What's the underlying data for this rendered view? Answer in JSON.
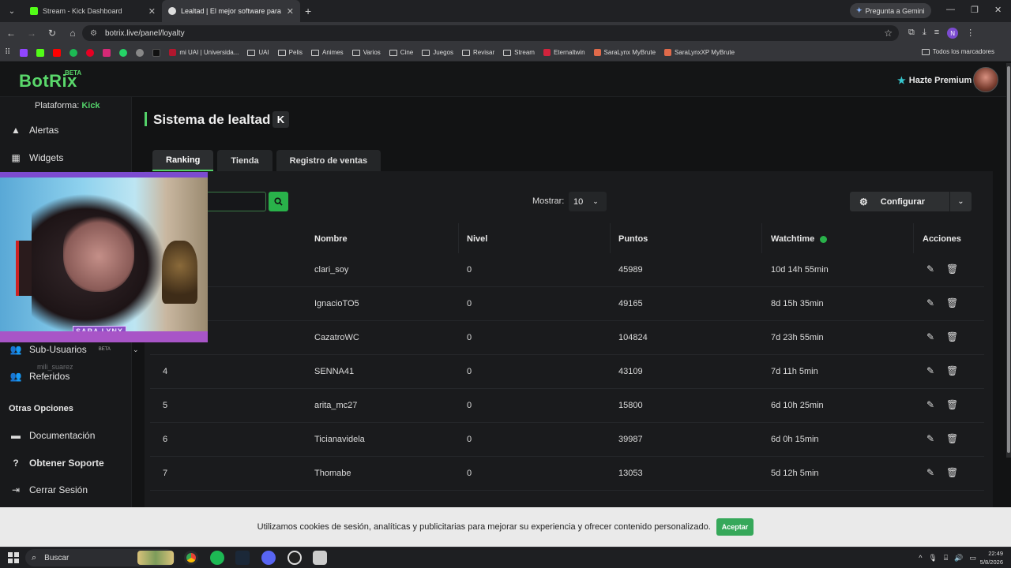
{
  "browser": {
    "tabs": [
      {
        "title": "Stream - Kick Dashboard",
        "favicon_color": "#53fc18"
      },
      {
        "title": "Lealtad | El mejor software para",
        "favicon_color": "#dddddd"
      }
    ],
    "gemini_label": "Pregunta a Gemini",
    "url": "botrix.live/panel/loyalty",
    "profile_initial": "N",
    "bookmarks": [
      {
        "label": "mi UAI | Universida...",
        "icon": "uai-icon"
      },
      {
        "label": "UAI",
        "icon": "folder-icon"
      },
      {
        "label": "Pelis",
        "icon": "folder-icon"
      },
      {
        "label": "Animes",
        "icon": "folder-icon"
      },
      {
        "label": "Varios",
        "icon": "folder-icon"
      },
      {
        "label": "Cine",
        "icon": "folder-icon"
      },
      {
        "label": "Juegos",
        "icon": "folder-icon"
      },
      {
        "label": "Revisar",
        "icon": "folder-icon"
      },
      {
        "label": "Stream",
        "icon": "folder-icon"
      },
      {
        "label": "Eternaltwin",
        "icon": "eternaltwin-icon"
      },
      {
        "label": "SaraLynx MyBrute",
        "icon": "mybrute-icon"
      },
      {
        "label": "SaraLynxXP MyBrute",
        "icon": "mybrute-icon"
      }
    ],
    "all_bookmarks": "Todos los marcadores"
  },
  "app": {
    "logo": "BotRix",
    "logo_badge": "BETA",
    "premium": "Hazte Premium",
    "platform_label": "Plataforma:",
    "platform_value": "Kick"
  },
  "sidebar": {
    "items_top": [
      {
        "label": "Alertas",
        "icon": "warning-icon"
      },
      {
        "label": "Widgets",
        "icon": "grid-icon"
      }
    ],
    "sub_users": {
      "label": "Sub-Usuarios",
      "badge": "BETA"
    },
    "referrals": "Referidos",
    "section_other": "Otras Opciones",
    "items_bottom": [
      {
        "label": "Documentación",
        "icon": "docs-icon"
      },
      {
        "label": "Obtener Soporte",
        "icon": "help-icon"
      },
      {
        "label": "Cerrar Sesión",
        "icon": "logout-icon"
      }
    ]
  },
  "webcam": {
    "overlay_name": "SARA LYNX",
    "ghost_user": "mili_suarez"
  },
  "main": {
    "title": "Sistema de lealtad",
    "tabs": [
      "Ranking",
      "Tienda",
      "Registro de ventas"
    ],
    "show_label": "Mostrar:",
    "show_value": "10",
    "configure": "Configurar",
    "columns": [
      "Nombre",
      "Nivel",
      "Puntos",
      "Watchtime",
      "Acciones"
    ],
    "rows": [
      {
        "rank": "",
        "name": "clari_soy",
        "level": "0",
        "points": "45989",
        "watchtime": "10d 14h 55min"
      },
      {
        "rank": "",
        "name": "IgnacioTO5",
        "level": "0",
        "points": "49165",
        "watchtime": "8d 15h 35min"
      },
      {
        "rank": "",
        "name": "CazatroWC",
        "level": "0",
        "points": "104824",
        "watchtime": "7d 23h 55min"
      },
      {
        "rank": "4",
        "name": "SENNA41",
        "level": "0",
        "points": "43109",
        "watchtime": "7d 11h 5min"
      },
      {
        "rank": "5",
        "name": "arita_mc27",
        "level": "0",
        "points": "15800",
        "watchtime": "6d 10h 25min"
      },
      {
        "rank": "6",
        "name": "Ticianavidela",
        "level": "0",
        "points": "39987",
        "watchtime": "6d 0h 15min"
      },
      {
        "rank": "7",
        "name": "Thomabe",
        "level": "0",
        "points": "13053",
        "watchtime": "5d 12h 5min"
      }
    ]
  },
  "cookie": {
    "text": "Utilizamos cookies de sesión, analíticas y publicitarias para mejorar su experiencia y ofrecer contenido personalizado.",
    "accept": "Aceptar"
  },
  "taskbar": {
    "search": "Buscar",
    "time": "22:49",
    "date": "5/8/2026"
  }
}
